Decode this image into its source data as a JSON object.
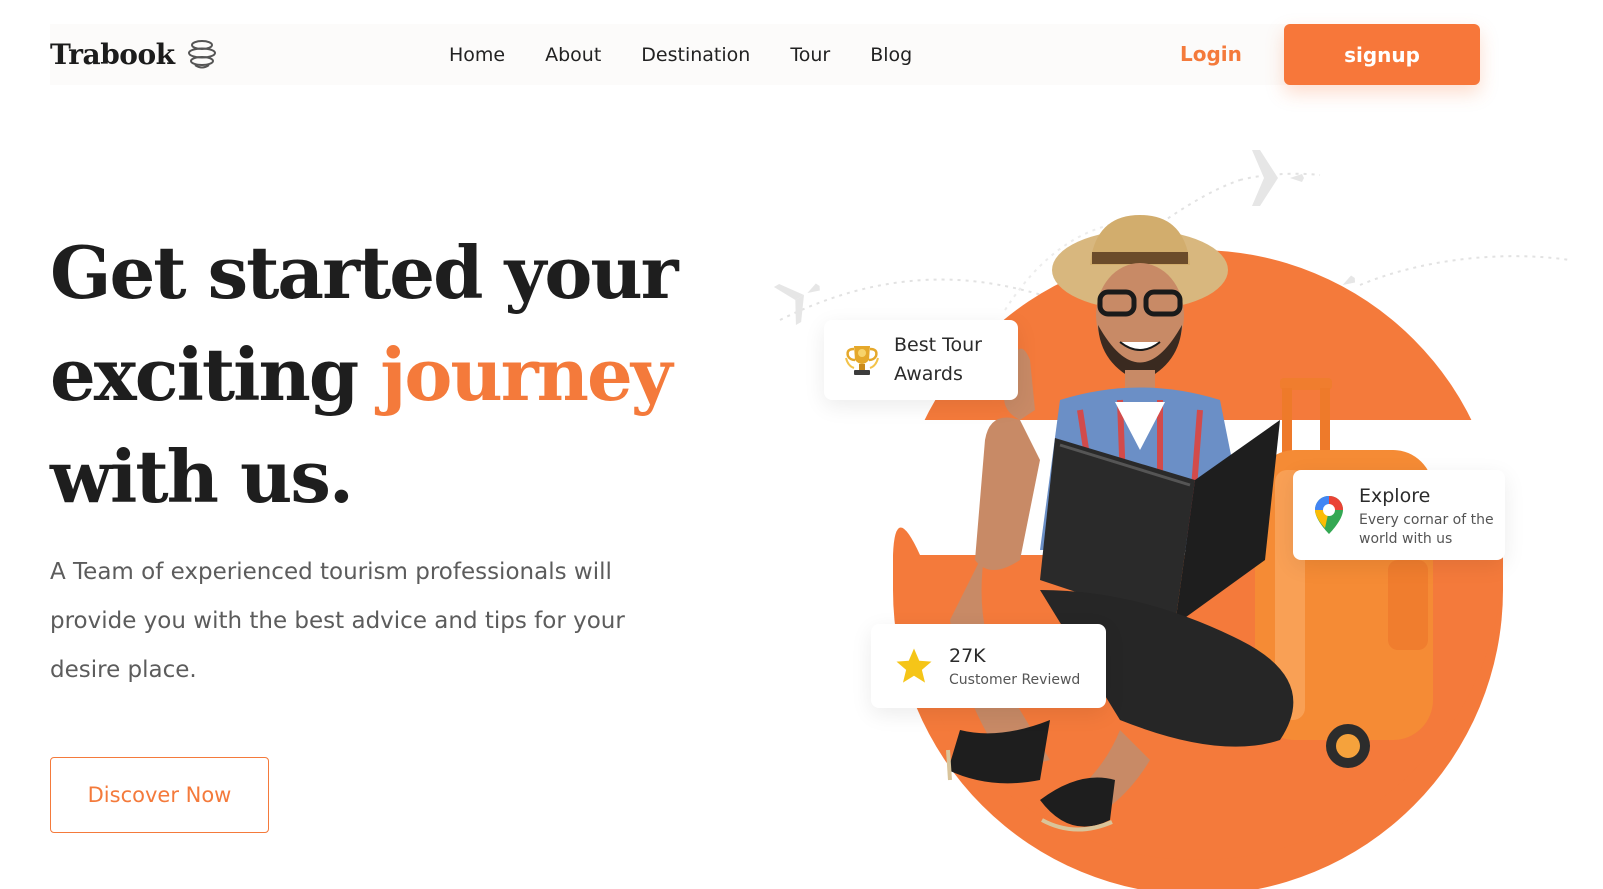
{
  "header": {
    "logo_text": "Trabook",
    "logo_icon": "globe-stack-icon",
    "nav": [
      {
        "label": "Home"
      },
      {
        "label": "About"
      },
      {
        "label": "Destination"
      },
      {
        "label": "Tour"
      },
      {
        "label": "Blog"
      }
    ],
    "login_label": "Login",
    "signup_label": "signup"
  },
  "hero": {
    "title_line1": "Get started your",
    "title_line2_prefix": "exciting ",
    "title_line2_accent": "journey",
    "title_line3": "with us.",
    "description": "A Team of experienced tourism professionals will provide you with the best advice and tips for your desire place.",
    "cta_label": "Discover Now"
  },
  "cards": {
    "awards": {
      "title": "Best Tour Awards",
      "icon": "trophy-icon"
    },
    "explore": {
      "title": "Explore",
      "subtitle": "Every cornar of the world with us",
      "icon": "map-pin-icon"
    },
    "reviews": {
      "title": "27K",
      "subtitle": "Customer Reviewd",
      "icon": "star-icon"
    }
  },
  "colors": {
    "accent": "#f47a3b",
    "dark_text": "#1e1e1e",
    "body_text": "#5c5c5c",
    "star": "#f5c518"
  }
}
